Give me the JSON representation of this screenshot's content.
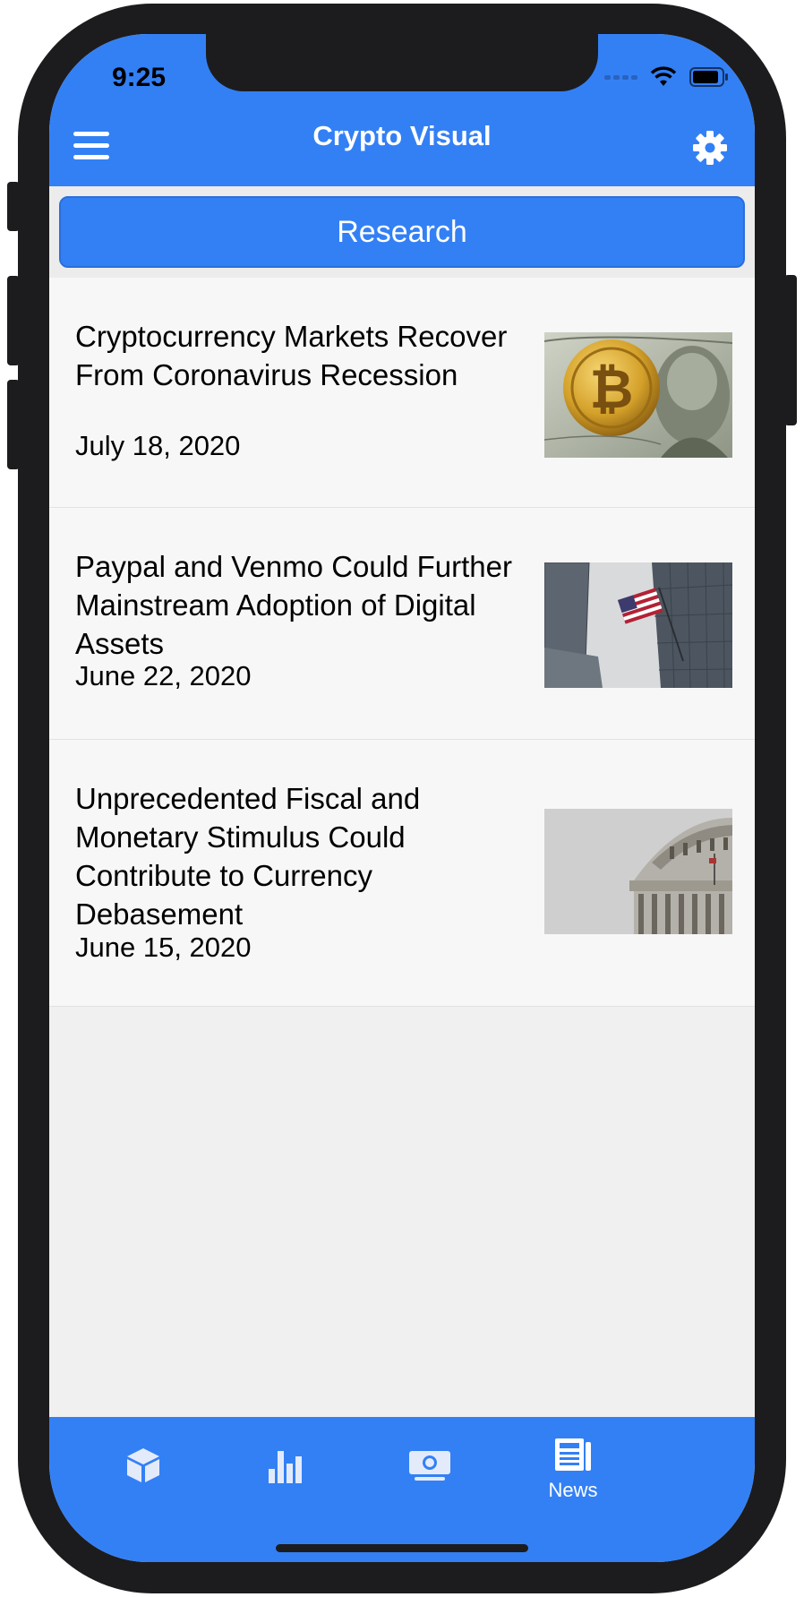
{
  "status": {
    "time": "9:25"
  },
  "header": {
    "title": "Crypto Visual"
  },
  "research": {
    "label": "Research"
  },
  "articles": [
    {
      "title": "Cryptocurrency Markets Recover From Coronavirus Recession",
      "date": "July 18, 2020",
      "image": "bitcoin-on-dollar-image"
    },
    {
      "title": "Paypal and Venmo Could Further Mainstream Adoption of Digital Assets",
      "date": "June 22, 2020",
      "image": "us-flag-building-image"
    },
    {
      "title": "Unprecedented Fiscal and Monetary Stimulus Could Contribute to Currency Debasement",
      "date": "June 15, 2020",
      "image": "capitol-dome-image"
    }
  ],
  "tabs": [
    {
      "icon": "cube-icon",
      "label": ""
    },
    {
      "icon": "bar-chart-icon",
      "label": ""
    },
    {
      "icon": "money-icon",
      "label": ""
    },
    {
      "icon": "newspaper-icon",
      "label": "News"
    }
  ],
  "colors": {
    "accent": "#3380f5",
    "background": "#f0f0f0",
    "item_bg": "#f7f7f7"
  }
}
